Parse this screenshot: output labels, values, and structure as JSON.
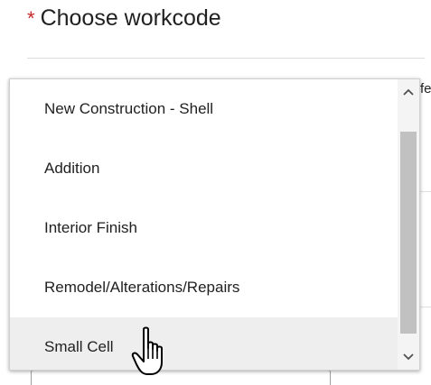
{
  "field": {
    "required_marker": "*",
    "label": "Choose workcode"
  },
  "background": {
    "truncated_text": "fe"
  },
  "dropdown": {
    "options": [
      {
        "label": "New Construction - Shell"
      },
      {
        "label": "Addition"
      },
      {
        "label": "Interior Finish"
      },
      {
        "label": "Remodel/Alterations/Repairs"
      },
      {
        "label": "Small Cell"
      }
    ],
    "hovered_index": 4,
    "scroll_up_icon": "▲",
    "scroll_down_icon": "▼"
  },
  "colors": {
    "required": "#c62828",
    "hover_bg": "#eeeeee"
  },
  "cursor_icon": "hand-pointer-icon"
}
